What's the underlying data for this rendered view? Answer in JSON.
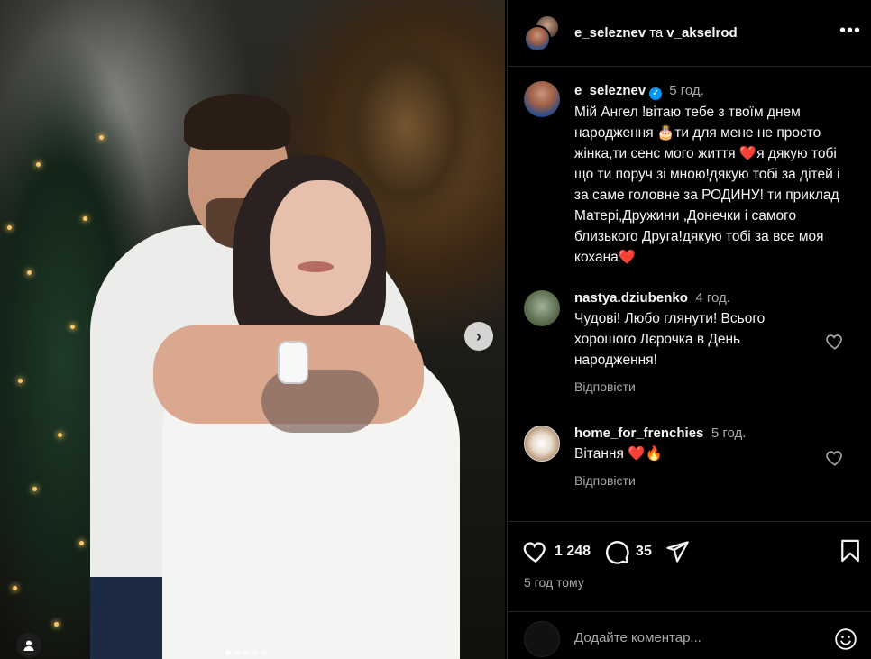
{
  "header": {
    "user1": "e_seleznev",
    "and": "та",
    "user2": "v_akselrod",
    "more": "•••"
  },
  "caption": {
    "username": "e_seleznev",
    "verified": "✓",
    "time": "5 год.",
    "text": "Мій Ангел !вітаю тебе з твоїм днем народження 🎂ти для мене не просто жінка,ти сенс мого життя ❤️я дякую тобі що ти поруч зі мною!дякую тобі за дітей і за саме головне за РОДИНУ! ти приклад Матері,Дружини ,Донечки і самого близького Друга!дякую тобі за все моя кохана❤️"
  },
  "comments": [
    {
      "username": "nastya.dziubenko",
      "time": "4 год.",
      "text": "Чудові! Любо глянути! Всього хорошого Лєрочка в День народження!",
      "reply": "Відповісти"
    },
    {
      "username": "home_for_frenchies",
      "time": "5 год.",
      "text": "Вітання ❤️🔥",
      "reply": "Відповісти"
    }
  ],
  "actions": {
    "likes": "1 248",
    "comments": "35",
    "posted_ago": "5 год тому"
  },
  "add_comment": {
    "placeholder": "Додайте коментар..."
  },
  "carousel": {
    "next_icon": "›",
    "dots": 5,
    "active_dot": 0
  },
  "colors": {
    "background": "#000000",
    "text": "#f5f5f5",
    "secondary_text": "#a8a8a8",
    "verified": "#0095f6",
    "divider": "#262626"
  }
}
